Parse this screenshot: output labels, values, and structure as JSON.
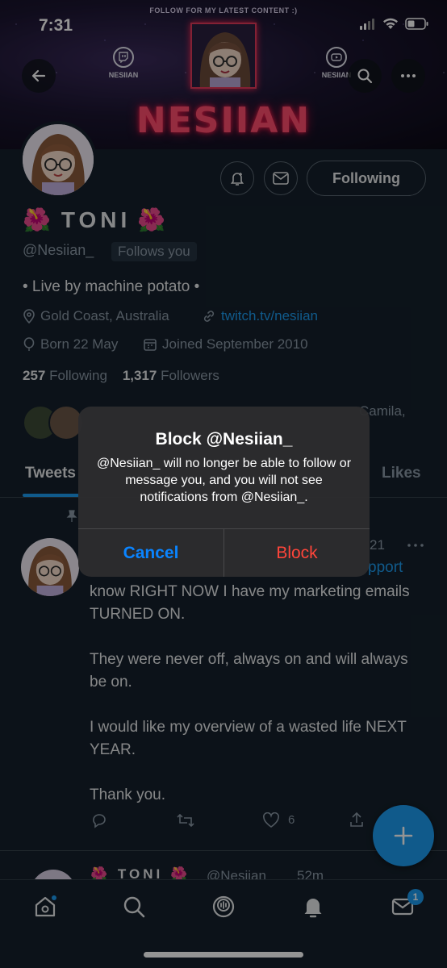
{
  "status_bar": {
    "time": "7:31"
  },
  "banner": {
    "top_text": "FOLLOW FOR MY LATEST CONTENT :)",
    "brand": "NESIIAN",
    "twitch_label": "NESIIAN",
    "youtube_label": "NESIIAN"
  },
  "profile": {
    "name": "TONI",
    "name_emoji": "🌺",
    "handle": "@Nesiian_",
    "follows_you": "Follows you",
    "following_button": "Following",
    "bio": "• Live by machine potato •",
    "location": "Gold Coast, Australia",
    "website": "twitch.tv/nesiian",
    "birthday": "Born 22 May",
    "joined": "Joined September 2010",
    "following_count": "257",
    "following_label": "Following",
    "followers_count": "1,317",
    "followers_label": "Followers",
    "followed_by_visible": "Camila,"
  },
  "tabs": {
    "tweets": "Tweets",
    "likes": "Likes"
  },
  "tweet": {
    "time_fragment": "21",
    "mention_fragment": "pport",
    "text": "know RIGHT NOW I have my marketing emails TURNED ON.\n\nThey were never off, always on and will always be on.\n\nI would like my overview of a wasted life NEXT YEAR.\n\nThank you.",
    "like_count": "6"
  },
  "next_tweet": {
    "name": "TONI",
    "handle": "@Nesiian_",
    "time": "52m"
  },
  "alert": {
    "title": "Block @Nesiian_",
    "message": "@Nesiian_ will no longer be able to follow or message you, and you will not see notifications from @Nesiian_.",
    "cancel_label": "Cancel",
    "block_label": "Block"
  },
  "nav": {
    "messages_badge": "1"
  },
  "colors": {
    "accent": "#1d9bf0",
    "background": "#15202b",
    "danger": "#ff453a",
    "ios_blue": "#0a84ff"
  }
}
